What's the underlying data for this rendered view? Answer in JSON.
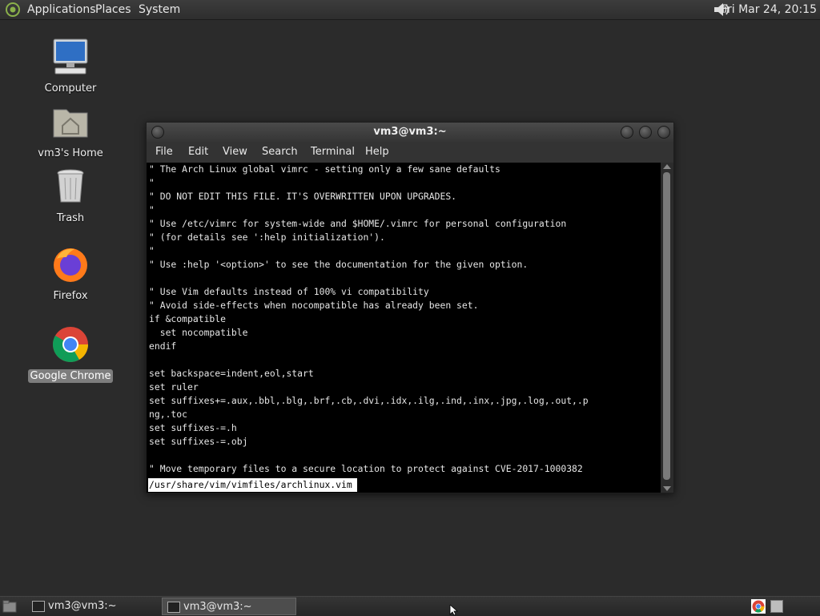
{
  "top_panel": {
    "menu": [
      "Applications",
      "Places",
      "System"
    ],
    "clock": "Fri Mar 24, 20:15"
  },
  "desktop": {
    "icons": [
      {
        "label": "Computer",
        "icon": "computer-icon"
      },
      {
        "label": "vm3's Home",
        "icon": "home-folder-icon"
      },
      {
        "label": "Trash",
        "icon": "trash-icon"
      },
      {
        "label": "Firefox",
        "icon": "firefox-icon"
      },
      {
        "label": "Google Chrome",
        "icon": "chrome-icon",
        "selected": true
      }
    ]
  },
  "window": {
    "title": "vm3@vm3:~",
    "menu": [
      "File",
      "Edit",
      "View",
      "Search",
      "Terminal",
      "Help"
    ],
    "terminal_lines": [
      "\" The Arch Linux global vimrc - setting only a few sane defaults",
      "\"",
      "\" DO NOT EDIT THIS FILE. IT'S OVERWRITTEN UPON UPGRADES.",
      "\"",
      "\" Use /etc/vimrc for system-wide and $HOME/.vimrc for personal configuration",
      "\" (for details see ':help initialization').",
      "\"",
      "\" Use :help '<option>' to see the documentation for the given option.",
      "",
      "\" Use Vim defaults instead of 100% vi compatibility",
      "\" Avoid side-effects when nocompatible has already been set.",
      "if &compatible",
      "  set nocompatible",
      "endif",
      "",
      "set backspace=indent,eol,start",
      "set ruler",
      "set suffixes+=.aux,.bbl,.blg,.brf,.cb,.dvi,.idx,.ilg,.ind,.inx,.jpg,.log,.out,.p",
      "ng,.toc",
      "set suffixes-=.h",
      "set suffixes-=.obj",
      "",
      "\" Move temporary files to a secure location to protect against CVE-2017-1000382"
    ],
    "status_line": "/usr/share/vim/vimfiles/archlinux.vim"
  },
  "bottom_panel": {
    "tasks": [
      {
        "label": "vm3@vm3:~",
        "active": false
      },
      {
        "label": "vm3@vm3:~",
        "active": true
      }
    ]
  }
}
